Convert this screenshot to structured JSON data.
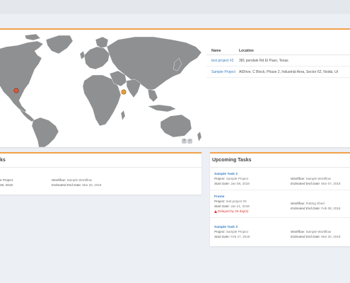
{
  "locations": {
    "headers": {
      "name": "Name",
      "location": "Location"
    },
    "rows": [
      {
        "name": "test project #2",
        "address": "381 pendale Rd El Paso, Texas"
      },
      {
        "name": "Sample Project",
        "address": "AtDrive, C Block, Phase 2, Industrial Area, Sector 62, Noida, Ut"
      }
    ]
  },
  "map": {
    "zoom_in": "+",
    "zoom_out": "−",
    "marker_colors": {
      "project_a": "#e05a3a",
      "project_b": "#e8a13a"
    },
    "land_color": "#8f9091",
    "ocean_color": "#ffffff"
  },
  "left_tasks": {
    "title_partial": "ks",
    "row": {
      "project_partial": "e Project",
      "date_partial": "26, 2018",
      "workflow_label": "Workflow",
      "workflow_value": ": Sample Workflow",
      "end_label": "Estimated End Date",
      "end_value": ": Mar 20, 2018"
    }
  },
  "upcoming": {
    "title": "Upcoming Tasks",
    "tasks": [
      {
        "name": "Sample Task 2",
        "project_label": "Project",
        "project": ": Sample Project",
        "start_label": "Start Date",
        "start": ": Jan 08, 2018",
        "workflow_label": "Workflow",
        "workflow": ": Sample Workflow",
        "end_label": "Estimated End Date",
        "end": ": Mar 07, 2018"
      },
      {
        "name": "Frame",
        "project_label": "Project",
        "project": ": test project #2",
        "start_label": "Start Date",
        "start": ": Jan 21, 2018",
        "workflow_label": "Workflow",
        "workflow": ": Putting Shed",
        "end_label": "Estimated End Date",
        "end": ": Feb 08, 2018",
        "delay": "Delayed by 26 day(s)"
      },
      {
        "name": "Sample Task 3",
        "project_label": "Project",
        "project": ": Sample Project",
        "start_label": "Start Date",
        "start": ": Feb 27, 2018",
        "workflow_label": "Workflow",
        "workflow": ": Sample Workflow",
        "end_label": "Estimated End Date",
        "end": ": Mar 20, 2018"
      }
    ]
  }
}
